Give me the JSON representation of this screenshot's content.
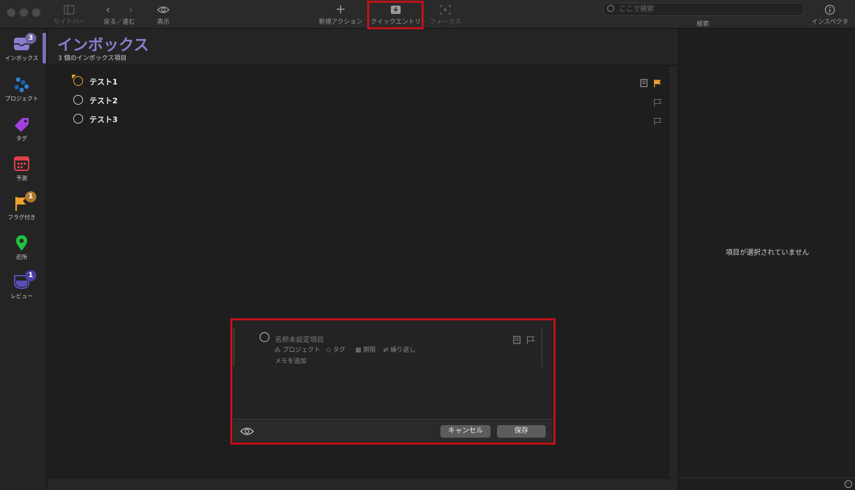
{
  "toolbar": {
    "sidebar_label": "サイドバー",
    "back_forward_label": "戻る／進む",
    "view_label": "表示",
    "new_action_label": "新規アクション",
    "quick_entry_label": "クイックエントリ",
    "focus_label": "フォーカス",
    "search_placeholder": "ここで検索",
    "search_label": "検索",
    "inspector_label": "インスペクタ"
  },
  "sidebar": {
    "items": [
      {
        "label": "インボックス",
        "icon": "inbox-icon",
        "badge": "3",
        "color": "#8a7fd0",
        "selected": true
      },
      {
        "label": "プロジェクト",
        "icon": "projects-icon",
        "color": "#2f7fd8"
      },
      {
        "label": "タグ",
        "icon": "tag-icon",
        "color": "#a040e0"
      },
      {
        "label": "予測",
        "icon": "forecast-icon",
        "color": "#e0404a"
      },
      {
        "label": "フラグ付き",
        "icon": "flag-icon",
        "badge": "1",
        "color": "#f0a030"
      },
      {
        "label": "近所",
        "icon": "location-pin-icon",
        "color": "#20c040"
      },
      {
        "label": "レビュー",
        "icon": "review-icon",
        "badge": "1",
        "color": "#5a4fb8"
      }
    ]
  },
  "main": {
    "title": "インボックス",
    "subtitle": "3 個のインボックス項目",
    "tasks": [
      {
        "label": "テスト1",
        "flagged": true,
        "has_note": true
      },
      {
        "label": "テスト2",
        "flagged": false,
        "has_note": false
      },
      {
        "label": "テスト3",
        "flagged": false,
        "has_note": false
      }
    ]
  },
  "quick_entry": {
    "placeholder": "名称未設定項目",
    "project_label": "プロジェクト",
    "tag_label": "タグ",
    "due_label": "期限",
    "repeat_label": "繰り返し",
    "note_placeholder": "メモを追加",
    "cancel_label": "キャンセル",
    "save_label": "保存"
  },
  "inspector": {
    "empty_message": "項目が選択されていません"
  },
  "colors": {
    "highlight": "#c0121b",
    "accent": "#8a7fd0",
    "flag_orange": "#f0a030"
  }
}
